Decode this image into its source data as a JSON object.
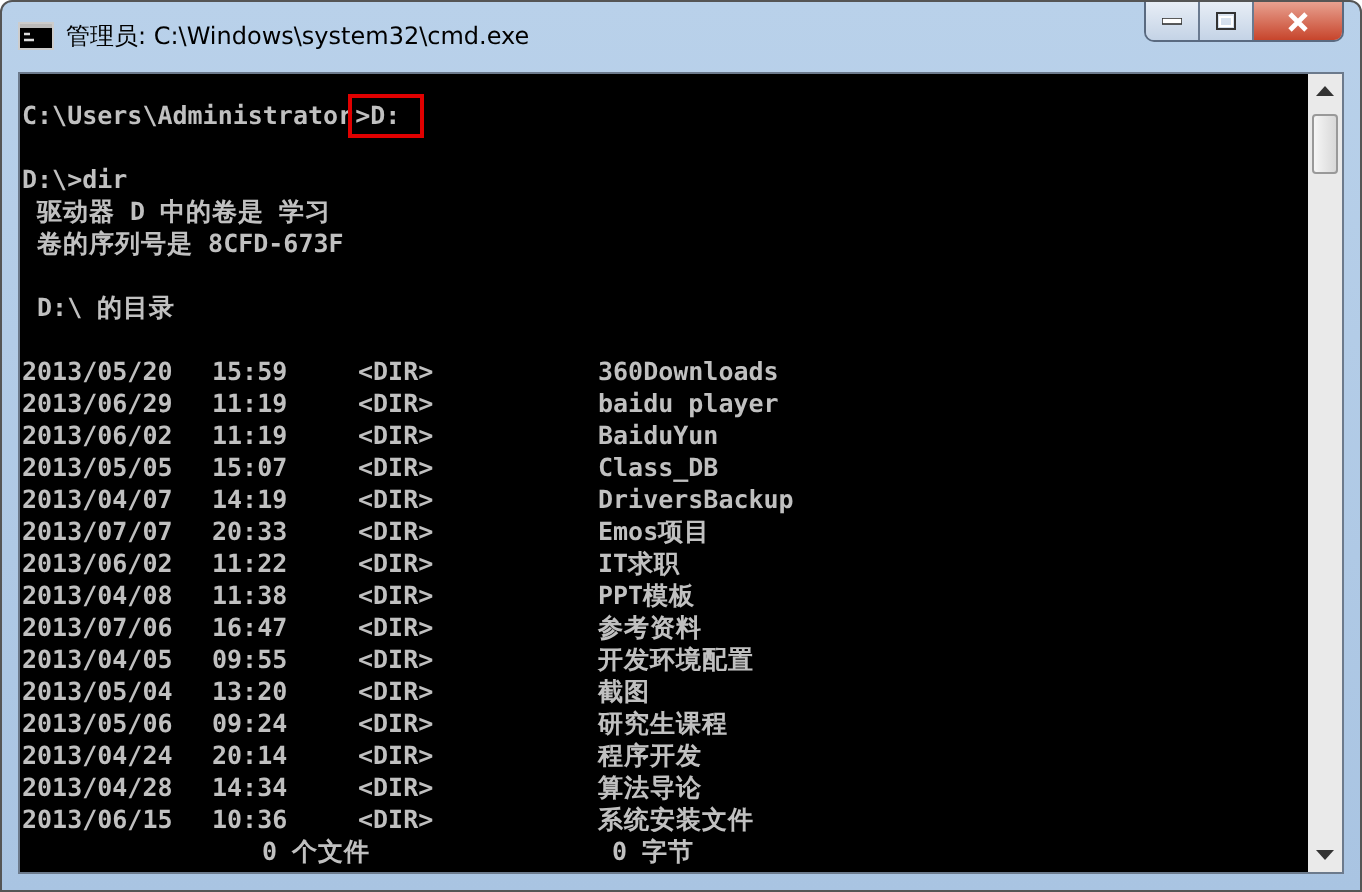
{
  "window": {
    "title": "管理员: C:\\Windows\\system32\\cmd.exe"
  },
  "console": {
    "lines": [
      {
        "kind": "prompt",
        "path": "C:\\Users\\Administrator",
        "command": ">D:",
        "highlighted": true
      },
      {
        "kind": "blank"
      },
      {
        "kind": "text",
        "text": "D:\\>dir"
      },
      {
        "kind": "text",
        "text": " 驱动器 D 中的卷是 学习"
      },
      {
        "kind": "text",
        "text": " 卷的序列号是 8CFD-673F"
      },
      {
        "kind": "blank"
      },
      {
        "kind": "text",
        "text": " D:\\ 的目录"
      },
      {
        "kind": "blank"
      },
      {
        "kind": "dir_row",
        "date": "2013/05/20",
        "time": "15:59",
        "type": "<DIR>",
        "name": "360Downloads"
      },
      {
        "kind": "dir_row",
        "date": "2013/06/29",
        "time": "11:19",
        "type": "<DIR>",
        "name": "baidu player"
      },
      {
        "kind": "dir_row",
        "date": "2013/06/02",
        "time": "11:19",
        "type": "<DIR>",
        "name": "BaiduYun"
      },
      {
        "kind": "dir_row",
        "date": "2013/05/05",
        "time": "15:07",
        "type": "<DIR>",
        "name": "Class_DB"
      },
      {
        "kind": "dir_row",
        "date": "2013/04/07",
        "time": "14:19",
        "type": "<DIR>",
        "name": "DriversBackup"
      },
      {
        "kind": "dir_row",
        "date": "2013/07/07",
        "time": "20:33",
        "type": "<DIR>",
        "name": "Emos项目"
      },
      {
        "kind": "dir_row",
        "date": "2013/06/02",
        "time": "11:22",
        "type": "<DIR>",
        "name": "IT求职"
      },
      {
        "kind": "dir_row",
        "date": "2013/04/08",
        "time": "11:38",
        "type": "<DIR>",
        "name": "PPT模板"
      },
      {
        "kind": "dir_row",
        "date": "2013/07/06",
        "time": "16:47",
        "type": "<DIR>",
        "name": "参考资料"
      },
      {
        "kind": "dir_row",
        "date": "2013/04/05",
        "time": "09:55",
        "type": "<DIR>",
        "name": "开发环境配置"
      },
      {
        "kind": "dir_row",
        "date": "2013/05/04",
        "time": "13:20",
        "type": "<DIR>",
        "name": "截图"
      },
      {
        "kind": "dir_row",
        "date": "2013/05/06",
        "time": "09:24",
        "type": "<DIR>",
        "name": "研究生课程"
      },
      {
        "kind": "dir_row",
        "date": "2013/04/24",
        "time": "20:14",
        "type": "<DIR>",
        "name": "程序开发"
      },
      {
        "kind": "dir_row",
        "date": "2013/04/28",
        "time": "14:34",
        "type": "<DIR>",
        "name": "算法导论"
      },
      {
        "kind": "dir_row",
        "date": "2013/06/15",
        "time": "10:36",
        "type": "<DIR>",
        "name": "系统安装文件"
      },
      {
        "kind": "summary",
        "files": "0 个文件",
        "bytes": "0 字节"
      }
    ]
  }
}
